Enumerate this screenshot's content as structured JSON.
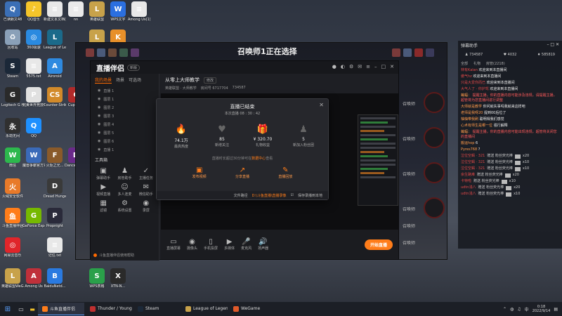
{
  "desktop_icons": [
    {
      "label": "已读朗文48",
      "color": "#3b6fb6",
      "glyph": "Q"
    },
    {
      "label": "QQ音乐",
      "color": "#f5c52a",
      "glyph": "♪"
    },
    {
      "label": "新建文本文档(4).txt",
      "color": "#e8e8e8",
      "glyph": "≡"
    },
    {
      "label": "nn",
      "color": "#eaeaea",
      "glyph": "≡"
    },
    {
      "label": "英雄联盟",
      "color": "#c8a24a",
      "glyph": "L"
    },
    {
      "label": "WPS文字",
      "color": "#2b6fe0",
      "glyph": "W"
    },
    {
      "label": "Among Us(1)-rar.s...",
      "color": "#e8e8e8",
      "glyph": "≡"
    },
    {
      "label": "回收站",
      "color": "#8aa0b8",
      "glyph": "♻"
    },
    {
      "label": "360极速",
      "color": "#2a8ae0",
      "glyph": "◎"
    },
    {
      "label": "League of Legends",
      "color": "#1b6a8a",
      "glyph": "L"
    },
    {
      "label": "英雄联盟",
      "color": "#c8a24a",
      "glyph": "L"
    },
    {
      "label": "王者荣耀",
      "color": "#e8902a",
      "glyph": "K"
    },
    {
      "label": "Steam",
      "color": "#1b2838",
      "glyph": "S"
    },
    {
      "label": "5575.txt",
      "color": "#e8e8e8",
      "glyph": "≡"
    },
    {
      "label": "Airoroid",
      "color": "#2e8ae0",
      "glyph": "A"
    },
    {
      "label": "Logitech G HUB",
      "color": "#2a2a2a",
      "glyph": "G"
    },
    {
      "label": "完美世界竞技平台",
      "color": "#e0e0e0",
      "glyph": "P"
    },
    {
      "label": "Counter-Strike Global Off...",
      "color": "#d28a2a",
      "glyph": "CS"
    },
    {
      "label": "Cuphead",
      "color": "#b02a2a",
      "glyph": "C"
    },
    {
      "label": "永劫无间",
      "color": "#303030",
      "glyph": "永"
    },
    {
      "label": "QQ",
      "color": "#1e90ff",
      "glyph": "Q"
    },
    {
      "label": "微信",
      "color": "#2db84d",
      "glyph": "W"
    },
    {
      "label": "魔兽争霸官方对战平台",
      "color": "#3a6ab8",
      "glyph": "W"
    },
    {
      "label": "火炬之光...",
      "color": "#8a5a2a",
      "glyph": "F"
    },
    {
      "label": "Dance of Death...",
      "color": "#6a2a8a",
      "glyph": "D"
    },
    {
      "label": "火绒安全软件",
      "color": "#e87a2a",
      "glyph": "火"
    },
    {
      "label": "Dread Hunger",
      "color": "#3a3a3a",
      "glyph": "D"
    },
    {
      "label": "斗鱼直播伴侣",
      "color": "#ff7d1a",
      "glyph": "鱼"
    },
    {
      "label": "GeForce Experience",
      "color": "#76b900",
      "glyph": "G"
    },
    {
      "label": "Propnight",
      "color": "#2a2a3a",
      "glyph": "P"
    },
    {
      "label": "网易云音乐",
      "color": "#e0252a",
      "glyph": "◎"
    },
    {
      "label": "记住.txt",
      "color": "#e8e8e8",
      "glyph": "≡"
    },
    {
      "label": "英雄联盟WeGame版",
      "color": "#c8a24a",
      "glyph": "L"
    },
    {
      "label": "Among Us",
      "color": "#c0303a",
      "glyph": "A"
    },
    {
      "label": "BaiduNetd...",
      "color": "#2a7ae0",
      "glyph": "B"
    },
    {
      "label": "WPS表格",
      "color": "#2aa04a",
      "glyph": "S"
    },
    {
      "label": "XTN-N...",
      "color": "#2a2a2a",
      "glyph": "X"
    }
  ],
  "game": {
    "title": "召唤师1正在选择",
    "side_label": "召唤师",
    "side_labels": [
      "召唤师",
      "召唤师",
      "召唤师",
      "召唤师",
      "召唤师",
      "召唤师"
    ]
  },
  "app": {
    "logo": "直播伴侣",
    "version": "新版",
    "sidebar_tabs": [
      "我的场景",
      "场景",
      "可选场"
    ],
    "scenes": [
      "直播 1",
      "图层 1",
      "图层 2",
      "图层 3",
      "图层 4",
      "图层 5",
      "图层 6",
      "直播 1"
    ],
    "tools_title": "工具箱",
    "tools": [
      {
        "label": "弹幕助手",
        "icon": "▣"
      },
      {
        "label": "房管助手",
        "icon": "♟"
      },
      {
        "label": "主播任务",
        "icon": "✓"
      },
      {
        "label": "视频直播",
        "icon": "▶"
      },
      {
        "label": "多人连麦",
        "icon": "☺"
      },
      {
        "label": "微信助手",
        "icon": "✉"
      },
      {
        "label": "滤镜",
        "icon": "▦"
      },
      {
        "label": "系统设置",
        "icon": "⚙"
      },
      {
        "label": "录屏",
        "icon": "◉"
      }
    ],
    "notice": "斗鱼直播伴侣使用帮助",
    "room_title": "从零上大师教学",
    "room_edit": "修改",
    "room_tag": "英雄联盟",
    "room_meta": [
      "英雄联盟 · 大师教学",
      "房间号 6717704",
      "734587"
    ],
    "bottom_tools": [
      {
        "label": "直播屏幕",
        "icon": "▭"
      },
      {
        "label": "摄像头",
        "icon": "◉"
      },
      {
        "label": "手机投屏",
        "icon": "▯"
      },
      {
        "label": "多媒体",
        "icon": "▶"
      },
      {
        "label": "麦克风",
        "icon": "🎤"
      },
      {
        "label": "扬声器",
        "icon": "🔊"
      }
    ],
    "start_button": "开始直播"
  },
  "dialog": {
    "title": "直播已结束",
    "duration": "本次直播 08 : 30 : 42",
    "stats": [
      {
        "value": "74.1万",
        "label": "最高热度",
        "icon": "🔥"
      },
      {
        "value": "85",
        "label": "新增关注",
        "icon": "♥"
      },
      {
        "value": "¥ 320.70",
        "label": "礼物收益",
        "icon": "🎁"
      },
      {
        "value": "5",
        "label": "新加入粉丝团",
        "icon": "♟"
      }
    ],
    "note_prefix": "直播时长超过30分钟可在",
    "note_link": "数据中心",
    "note_suffix": "查看",
    "actions": [
      {
        "label": "发布视频",
        "icon": "▣"
      },
      {
        "label": "分享直播",
        "icon": "↗"
      },
      {
        "label": "直播回放",
        "icon": "✎"
      }
    ],
    "footer_text": "文件路径",
    "footer_path": "D:\\斗鱼直播\\直播录像",
    "footer_check": "保存录播到本地"
  },
  "chat": {
    "title": "弹幕助手",
    "stats": [
      "734587",
      "4032",
      "585819"
    ],
    "tabs": [
      "全部",
      "礼物",
      "房管(2218)"
    ],
    "messages": [
      {
        "user": "林有Kalan",
        "text": "欢迎来到本直播间",
        "type": "welcome"
      },
      {
        "user": "傲气hz",
        "text": "欢迎来到本直播间",
        "type": "welcome"
      },
      {
        "user": "只是大爱你而已",
        "text": "欢迎来到本直播间",
        "type": "welcome"
      },
      {
        "user": "大气人了 · 你护驾",
        "text": "欢迎来到本直播间",
        "type": "welcome"
      },
      {
        "user": "蝙蝠：",
        "text": "提醒主播，你的直播内容可能涉及违规，请提醒主播，超管将为您直播间进行调整",
        "type": "system"
      },
      {
        "user": "大师就是教学",
        "text": "你问就失事吗我就来这样吧",
        "type": "chat"
      },
      {
        "user": "老师是我呀20",
        "text": "提到00后位了",
        "type": "chat"
      },
      {
        "user": "柚柚带我刷",
        "text": "聪明得我们感觉",
        "type": "chat"
      },
      {
        "user": "心术有师生是哪一位",
        "text": "强行解释",
        "type": "chat"
      },
      {
        "user": "蝙蝠：",
        "text": "提醒主播，你的直播内容可能出现违规，超管将关闭您的直播间",
        "type": "system"
      },
      {
        "user": "搬运hop",
        "text": "6",
        "type": "chat"
      },
      {
        "user": "Pyres768",
        "text": "?",
        "type": "chat"
      }
    ],
    "gifts": [
      {
        "user": "泣位空蝎 · 321",
        "text": "赠送 粉丝荧光棒",
        "count": "x20"
      },
      {
        "user": "泣位空蝎 · 321",
        "text": "赠送 粉丝荧光棒",
        "count": "x10"
      },
      {
        "user": "泣位空蝎 · 321",
        "text": "赠送 粉丝荧光棒",
        "count": "x10"
      },
      {
        "user": "余生路难",
        "text": "赠送 粉丝荧光棒",
        "count": "x20"
      },
      {
        "user": "卡特啦",
        "text": "赠送 粉丝荧光棒",
        "count": "x10"
      },
      {
        "user": "udtn浅八",
        "text": "赠送 粉丝荧光棒",
        "count": "x20"
      },
      {
        "user": "udtn浅八",
        "text": "赠送 粉丝荧光棒",
        "count": "x10"
      }
    ]
  },
  "taskbar": {
    "apps": [
      {
        "label": "斗鱼直播伴侣",
        "color": "#ff7d1a",
        "active": true
      },
      {
        "label": "Thunder / Young...",
        "color": "#c03030",
        "active": false
      },
      {
        "label": "Steam",
        "color": "#1b2838",
        "active": false
      },
      {
        "label": "League of Legends",
        "color": "#c8a24a",
        "active": false
      },
      {
        "label": "WeGame",
        "color": "#e05a2a",
        "active": false
      }
    ],
    "time": "0:18",
    "date": "2022/9/14",
    "lang": "中"
  }
}
